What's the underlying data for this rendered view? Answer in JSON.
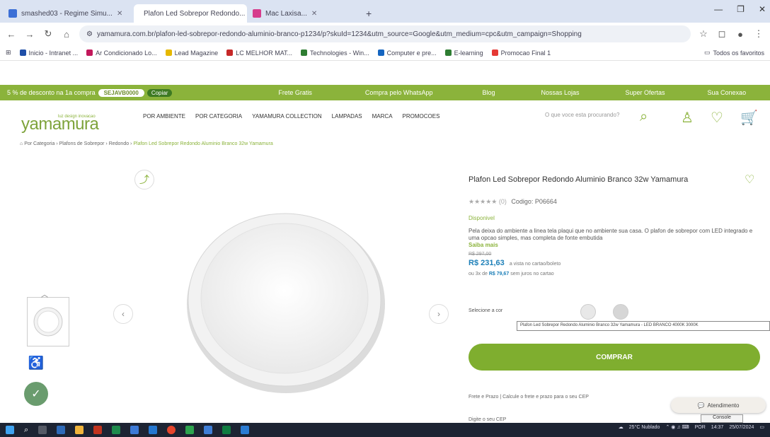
{
  "browser": {
    "tabs": [
      {
        "label": "smashed03 - Regime Simu...",
        "color": "#3c6fd6"
      },
      {
        "label": "Plafon Led Sobrepor Redondo...",
        "color": "#8bb33b",
        "active": true
      },
      {
        "label": "Mac Laxisa...",
        "color": "#d63c8c"
      }
    ],
    "new_tab": "+",
    "url": "yamamura.com.br/plafon-led-sobrepor-redondo-aluminio-branco-p1234/p?skuId=1234&utm_source=Google&utm_medium=cpc&utm_campaign=Shopping",
    "bookmarks": [
      "Inicio - Intranet ...",
      "Ar Condicionado Lo...",
      "Lead Magazine",
      "LC MELHOR MAT...",
      "Technologies - Win...",
      "Computer e pre...",
      "E-learning",
      "Promocao Final 1"
    ],
    "bookmarks_all": "Todos os favoritos"
  },
  "promo": {
    "items": [
      "5 % de desconto na 1a compra",
      "Frete Gratis",
      "Compra pelo WhatsApp",
      "Blog",
      "Nossas Lojas",
      "Super Ofertas",
      "Sua Conexao"
    ],
    "coupon": "SEJAVB0000",
    "copy": "Copiar"
  },
  "header": {
    "logo": "yamamura",
    "tagline": "luz design inovacao",
    "nav": [
      "POR AMBIENTE",
      "POR CATEGORIA",
      "YAMAMURA COLLECTION",
      "LAMPADAS",
      "MARCA",
      "PROMOCOES"
    ],
    "search_placeholder": "O que voce esta procurando?"
  },
  "breadcrumb": {
    "items": [
      "Por Categoria",
      "Plafons de Sobrepor",
      "Redondo"
    ],
    "current": "Plafon Led Sobrepor Redondo Aluminio Branco 32w Yamamura"
  },
  "product": {
    "title": "Plafon Led Sobrepor Redondo Aluminio Branco 32w Yamamura",
    "stars": "★★★★★",
    "rating_count": "(0)",
    "code": "Codigo: P06664",
    "stock": "Disponivel",
    "description": "Pela deixa do ambiente a linea tela plaqui que no ambiente sua casa. O plafon de sobrepor com LED integrado e uma opcao simples, mas completa de fonte embutida",
    "more": "Saiba mais",
    "old_price": "R$ 297,00",
    "price": "R$ 231,63",
    "price_note": "a vista no cartao/boleto",
    "installments_prefix": "ou 3x de",
    "installments_value": "R$ 79,67",
    "installments_suffix": "sem juros no cartao",
    "select_label": "Selecione a cor",
    "tooltip": "Plafon Led Sobrepor Redondo Aluminio Branco 32w Yamamura - LED BRANCO 4000K 3000K",
    "buy": "COMPRAR",
    "shipping": "Frete e Prazo | Calcule o frete e prazo para o seu CEP",
    "cep_label": "Digite o seu CEP"
  },
  "chat": "Atendimento",
  "console": "Console",
  "tray": {
    "weather": "25°C Nublado",
    "time": "14:37",
    "date": "25/07/2024",
    "lang": "POR"
  }
}
